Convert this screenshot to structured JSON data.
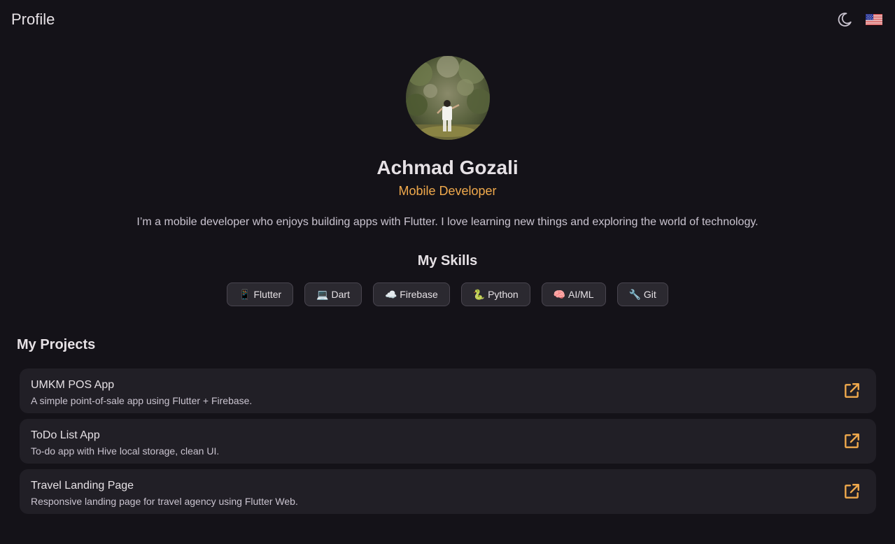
{
  "appbar": {
    "title": "Profile",
    "theme_icon": "moon-icon",
    "language_icon": "us-flag-icon"
  },
  "profile": {
    "name": "Achmad Gozali",
    "role": "Mobile Developer",
    "bio": "I’m a mobile developer who enjoys building apps with Flutter. I love learning new things and exploring the world of technology."
  },
  "skills": {
    "title": "My Skills",
    "items": [
      {
        "emoji": "📱",
        "label": "Flutter"
      },
      {
        "emoji": "💻",
        "label": "Dart"
      },
      {
        "emoji": "☁️",
        "label": "Firebase"
      },
      {
        "emoji": "🐍",
        "label": "Python"
      },
      {
        "emoji": "🧠",
        "label": "AI/ML"
      },
      {
        "emoji": "🔧",
        "label": "Git"
      }
    ]
  },
  "projects": {
    "title": "My Projects",
    "items": [
      {
        "title": "UMKM POS App",
        "description": "A simple point-of-sale app using Flutter + Firebase.",
        "icon": "open-in-new-icon"
      },
      {
        "title": "ToDo List App",
        "description": "To-do app with Hive local storage, clean UI.",
        "icon": "open-in-new-icon"
      },
      {
        "title": "Travel Landing Page",
        "description": "Responsive landing page for travel agency using Flutter Web.",
        "icon": "open-in-new-icon"
      }
    ]
  },
  "colors": {
    "background": "#141218",
    "accent": "#f0a94c",
    "card": "#211f26",
    "chip": "#2b2930"
  }
}
